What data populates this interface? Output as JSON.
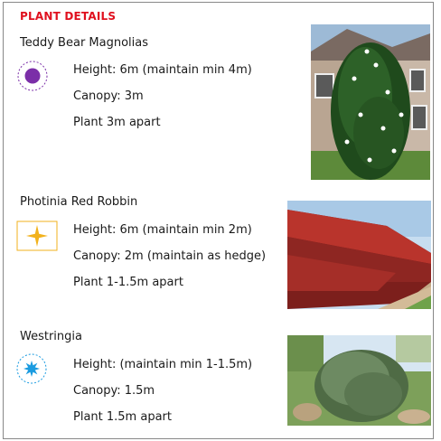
{
  "heading": "PLANT DETAILS",
  "plants": [
    {
      "name": "Teddy Bear Magnolias",
      "height": "Height: 6m (maintain min 4m)",
      "canopy": "Canopy: 3m",
      "spacing": "Plant 3m apart",
      "symbol": "purple-dot-circle-icon",
      "symbol_color": "#7b2fa8"
    },
    {
      "name": "Photinia Red Robbin",
      "height": "Height: 6m (maintain min 2m)",
      "canopy": "Canopy: 2m (maintain as hedge)",
      "spacing": "Plant 1-1.5m apart",
      "symbol": "yellow-star-square-icon",
      "symbol_color": "#f2b21d"
    },
    {
      "name": "Westringia",
      "height": "Height: (maintain min 1-1.5m)",
      "canopy": "Canopy: 1.5m",
      "spacing": "Plant 1.5m apart",
      "symbol": "blue-star-circle-icon",
      "symbol_color": "#1a9be0"
    }
  ]
}
